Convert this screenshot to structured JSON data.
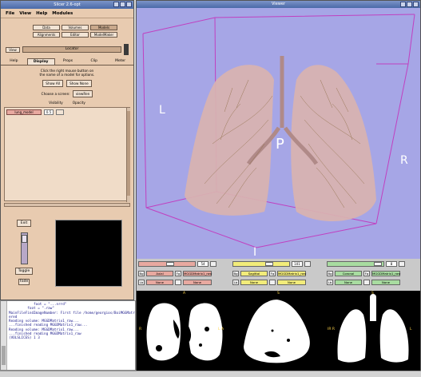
{
  "slicer": {
    "title": "Slicer 2.6-opt",
    "menu": [
      "File",
      "View",
      "Help",
      "Modules"
    ],
    "modules_row1": [
      "Data",
      "Volumes",
      "Models"
    ],
    "modules_row2": [
      "Alignments",
      "Editor",
      "ModelMaker"
    ],
    "view_label": "View",
    "locator_label": "Locator",
    "tabs": [
      "Help",
      "Display",
      "Props",
      "Clip",
      "Meter"
    ],
    "hint_line1": "Click the right mouse button on",
    "hint_line2": "the name of a model for options.",
    "show_all": "Show All",
    "show_none": "Show None",
    "choose_screen": "Choose a screen:",
    "viewRen": "viewRen",
    "col_visibility": "Visibility",
    "col_opacity": "Opacity",
    "model_name": "lung_model",
    "model_opacity": "0.5",
    "exit": "Exit",
    "toggle": "Toggle",
    "fade": "Fade"
  },
  "terminal": {
    "lines": [
      "            foot = \"...nrrd\"",
      "         foot = \".raw\"",
      "MainFileFindImageNumber: First file /home/georgios/BoiMGGMatrix_mu...",
      "ered",
      "Reading volume: MGGDMatrix1_raw...",
      "...finished reading MGGDMatrix1_raw...",
      "Reading volume: MGGDMatrix1_raw...",
      "...finished reading MGGDMatrix1_raw",
      "(VOLSLICES) 1 3"
    ]
  },
  "viewer": {
    "title": "Viewer",
    "orient_left": "L",
    "orient_right": "R",
    "orient_center": "P",
    "orient_bottom": "I"
  },
  "slices": [
    {
      "color": "#e8a9a0",
      "value": "54",
      "orient": "Axial",
      "fg_label": "Fg",
      "bg_label": "Bg",
      "lb_label": "Lb",
      "volume": "MGGDMatrix1_raw",
      "none1": "None",
      "none2": "None",
      "labels": {
        "top": "A",
        "left": "R",
        "right": "L A"
      }
    },
    {
      "color": "#f2ec7a",
      "value": "101",
      "orient": "Sagittal",
      "fg_label": "Fg",
      "bg_label": "Bg",
      "lb_label": "Lb",
      "volume": "MGGDMatrix1_raw",
      "none1": "None",
      "none2": "None",
      "labels": {
        "top": "S",
        "left": "",
        "right": ""
      }
    },
    {
      "color": "#a8dca0",
      "value": "8",
      "orient": "Coronal",
      "fg_label": "Fg",
      "bg_label": "Bg",
      "lb_label": "Lb",
      "volume": "MGGDMatrix1_raw",
      "none1": "None",
      "none2": "None",
      "labels": {
        "top": "S",
        "left": "IR R",
        "right": "L"
      }
    }
  ],
  "colors": {
    "scene_bg": "#a6a6e6",
    "lung": "#d9b3b0",
    "bbox": "#c040c0",
    "title_bar": "#4a6aa8"
  }
}
